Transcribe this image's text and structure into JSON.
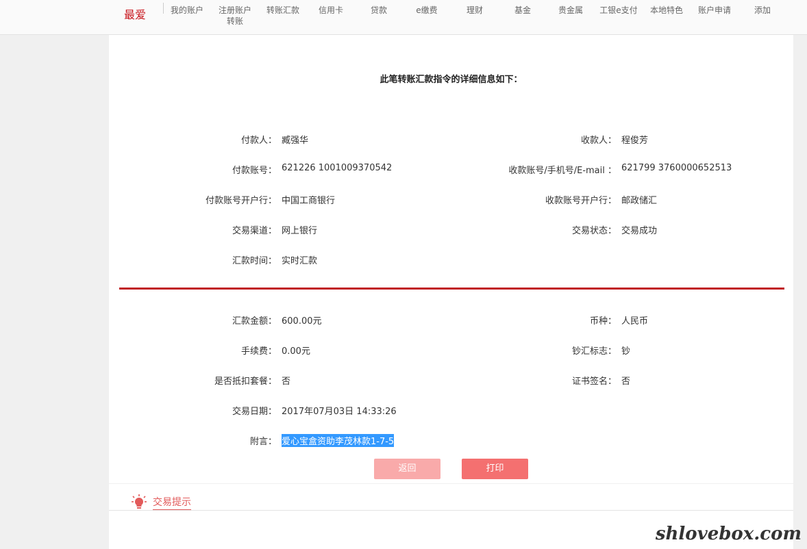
{
  "nav": {
    "fav_label": "最爱",
    "items": [
      {
        "label": "我的账户"
      },
      {
        "label": "注册账户\n转账"
      },
      {
        "label": "转账汇款"
      },
      {
        "label": "信用卡"
      },
      {
        "label": "贷款"
      },
      {
        "label": "e缴费"
      },
      {
        "label": "理财"
      },
      {
        "label": "基金"
      },
      {
        "label": "贵金属"
      },
      {
        "label": "工银e支付"
      },
      {
        "label": "本地特色"
      },
      {
        "label": "账户申请"
      },
      {
        "label": "添加"
      }
    ]
  },
  "detail": {
    "title": "此笔转账汇款指令的详细信息如下：",
    "payer_label": "付款人：",
    "payer": "臧强华",
    "payee_label": "收款人：",
    "payee": "程俊芳",
    "payer_account_label": "付款账号：",
    "payer_account": "621226 1001009370542",
    "payee_account_label": "收款账号/手机号/E-mail ：",
    "payee_account": "621799 3760000652513",
    "payer_bank_label": "付款账号开户行：",
    "payer_bank": "中国工商银行",
    "payee_bank_label": "收款账号开户行：",
    "payee_bank": "邮政储汇",
    "channel_label": "交易渠道：",
    "channel": "网上银行",
    "status_label": "交易状态：",
    "status": "交易成功",
    "remit_time_label": "汇款时间：",
    "remit_time": "实时汇款",
    "amount_label": "汇款金额：",
    "amount": "600.00元",
    "currency_label": "币种：",
    "currency": "人民币",
    "fee_label": "手续费：",
    "fee": "0.00元",
    "cash_flag_label": "钞汇标志：",
    "cash_flag": "钞",
    "package_label": "是否抵扣套餐：",
    "package": "否",
    "cert_label": "证书签名：",
    "cert": "否",
    "date_label": "交易日期：",
    "date": "2017年07月03日 14:33:26",
    "note_label": "附言：",
    "note": "爱心宝盒资助李茂林款1-7-5"
  },
  "buttons": {
    "back": "返回",
    "print": "打印"
  },
  "tips": {
    "tab_label": "交易提示"
  },
  "watermark": "shlovebox.com",
  "colors": {
    "accent_red": "#c01a22",
    "back_button": "#f9aaaa",
    "print_button": "#f47070",
    "highlight": "#3399ff"
  }
}
